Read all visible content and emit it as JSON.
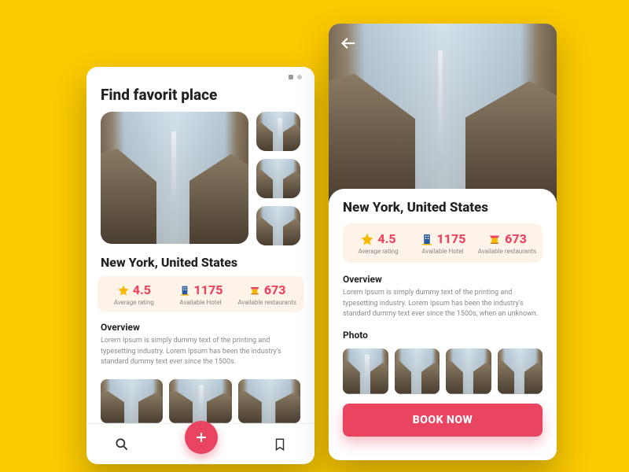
{
  "screenA": {
    "header": "Find favorit place",
    "place_title": "New York, United States",
    "stats": {
      "rating": {
        "value": "4.5",
        "label": "Average rating"
      },
      "hotels": {
        "value": "1175",
        "label": "Available Hotel"
      },
      "restaurants": {
        "value": "673",
        "label": "Available restaurants"
      }
    },
    "overview_heading": "Overview",
    "overview_text": "Lorem Ipsum is simply dummy text of the printing and typesetting industry. Lorem Ipsum has been the industry's standard dummy text ever since the 1500s."
  },
  "screenB": {
    "place_title": "New York, United States",
    "stats": {
      "rating": {
        "value": "4.5",
        "label": "Average rating"
      },
      "hotels": {
        "value": "1175",
        "label": "Available Hotel"
      },
      "restaurants": {
        "value": "673",
        "label": "Available restaurants"
      }
    },
    "overview_heading": "Overview",
    "overview_text": "Lorem Ipsum is simply dummy text of the printing and typesetting industry. Lorem Ipsum has been the industry's standard dummy text ever since the 1500s, when an unknown.",
    "photo_heading": "Photo",
    "book_label": "BOOK NOW"
  }
}
